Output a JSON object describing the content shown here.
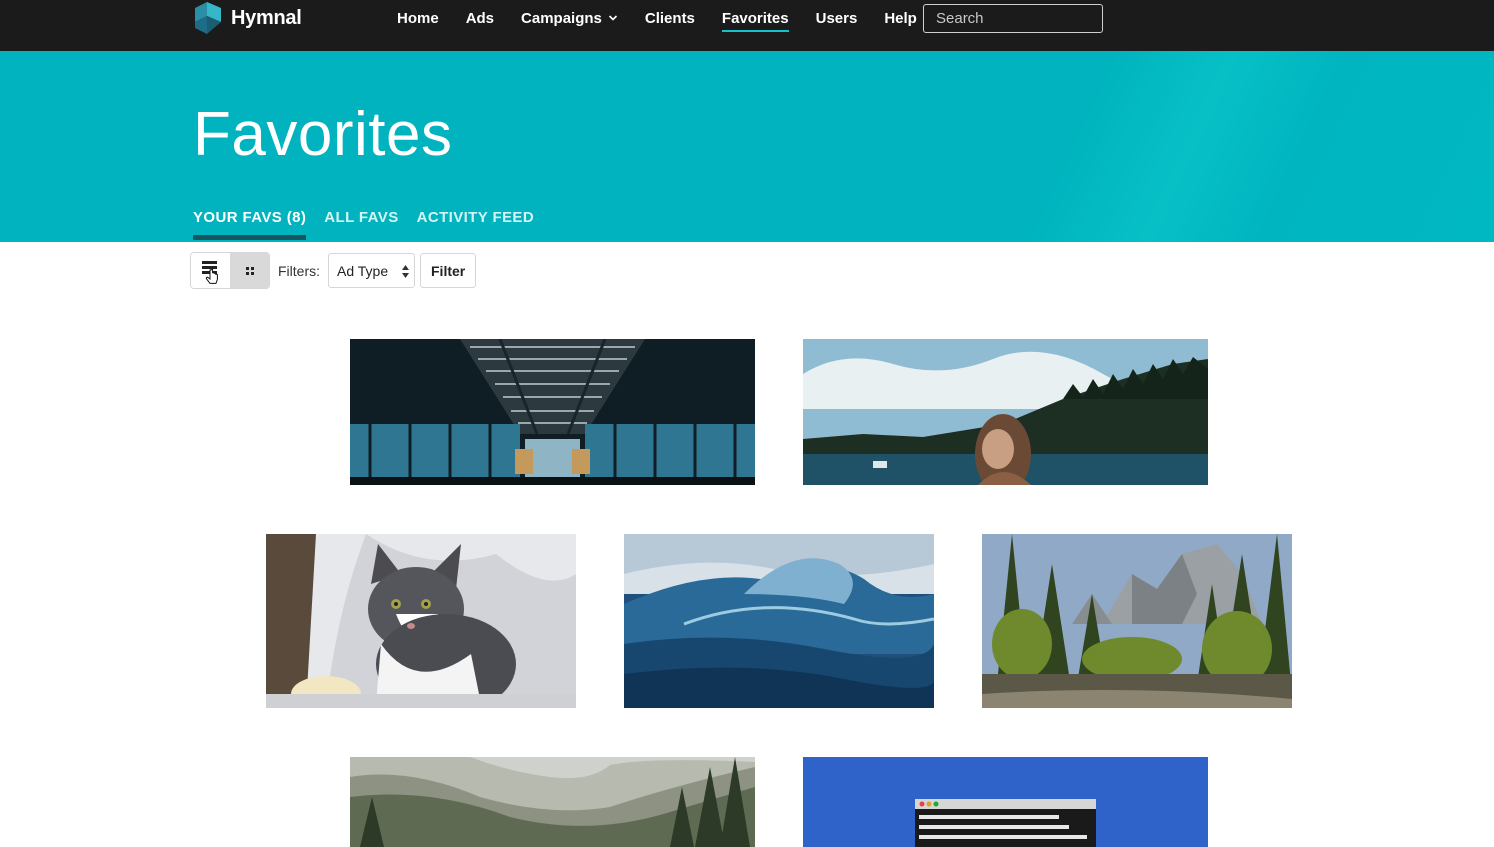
{
  "app": {
    "name": "Hymnal"
  },
  "nav": {
    "items": [
      {
        "label": "Home",
        "active": false
      },
      {
        "label": "Ads",
        "active": false
      },
      {
        "label": "Campaigns",
        "active": false,
        "has_dropdown": true
      },
      {
        "label": "Clients",
        "active": false
      },
      {
        "label": "Favorites",
        "active": true
      },
      {
        "label": "Users",
        "active": false
      },
      {
        "label": "Help",
        "active": false
      }
    ],
    "search_placeholder": "Search"
  },
  "hero": {
    "title": "Favorites",
    "tabs": [
      {
        "label": "YOUR FAVS (8)",
        "active": true
      },
      {
        "label": "ALL FAVS",
        "active": false
      },
      {
        "label": "ACTIVITY FEED",
        "active": false
      }
    ]
  },
  "toolbar": {
    "filters_label": "Filters:",
    "ad_type_selected": "Ad Type",
    "filter_button": "Filter"
  },
  "gallery": {
    "items": [
      {
        "subject": "train station interior"
      },
      {
        "subject": "woman by mountain lake"
      },
      {
        "subject": "grey and white cat"
      },
      {
        "subject": "ocean wave"
      },
      {
        "subject": "forest and granite cliffs"
      },
      {
        "subject": "misty forest hills"
      },
      {
        "subject": "terminal window on blue"
      }
    ]
  },
  "colors": {
    "topbar": "#1b1b1b",
    "hero": "#00b5bf",
    "accent": "#16c2c7",
    "tab_indicator": "#165660"
  }
}
